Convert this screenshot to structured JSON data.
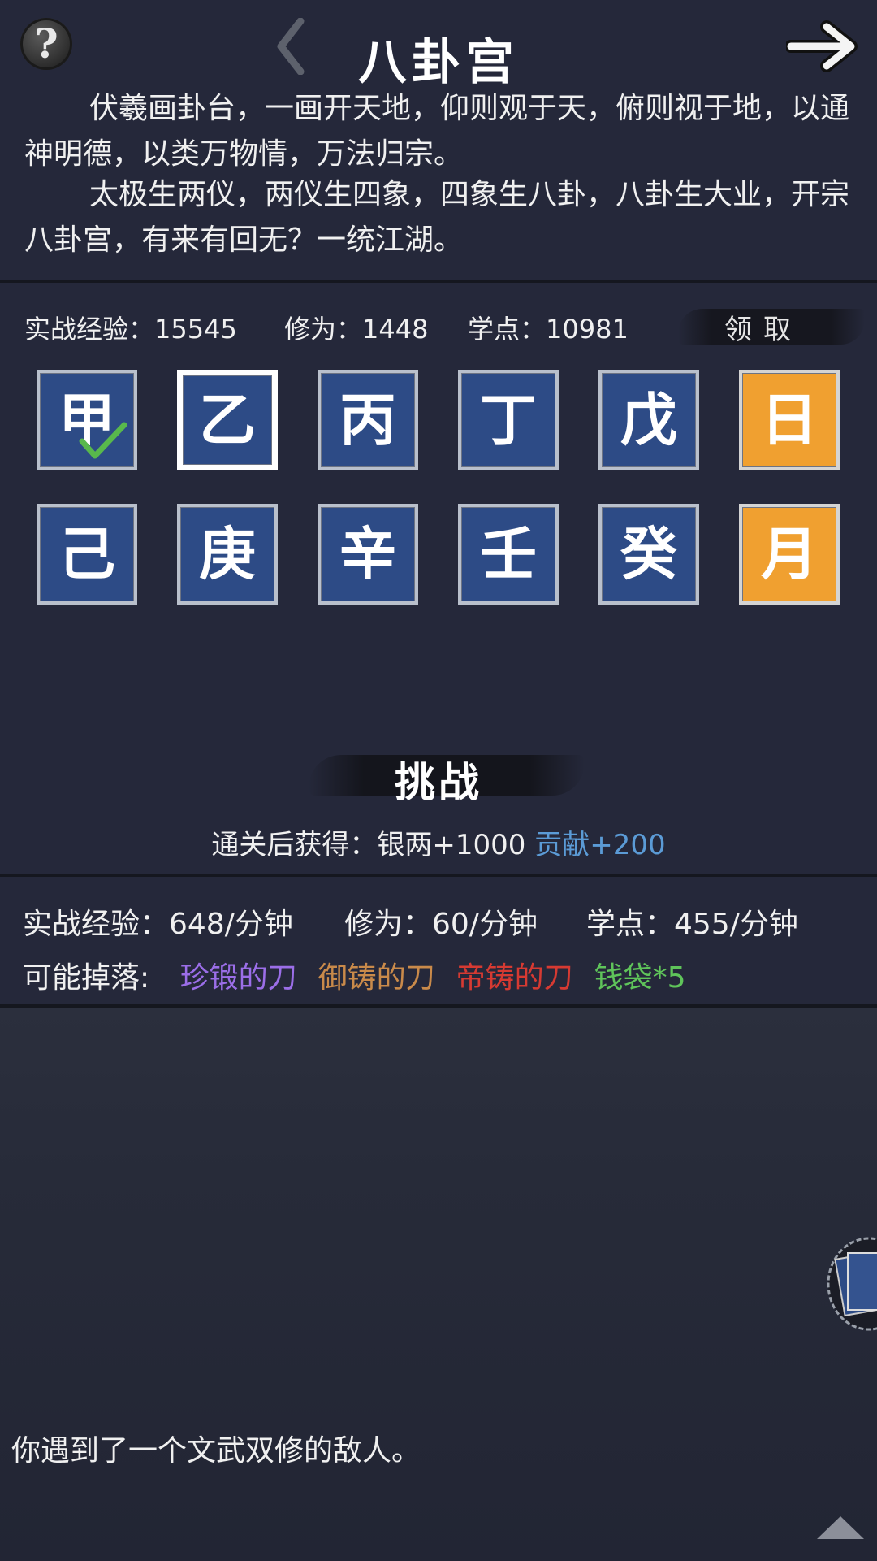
{
  "header": {
    "help_label": "?",
    "title": "八卦宫"
  },
  "intro": {
    "paragraph_1": "伏羲画卦台，一画开天地，仰则观于天，俯则视于地，以通神明德，以类万物情，万法归宗。",
    "paragraph_2": "太极生两仪，两仪生四象，四象生八卦，八卦生大业，开宗八卦宫，有来有回无？一统江湖。"
  },
  "stats": {
    "combat_exp": "实战经验：15545",
    "cultivation": "修为：1448",
    "study_points": "学点：10981",
    "claim_label": "领取"
  },
  "tiles": [
    {
      "char": "甲",
      "color": "blue",
      "completed": true
    },
    {
      "char": "乙",
      "color": "blue",
      "selected": true
    },
    {
      "char": "丙",
      "color": "blue"
    },
    {
      "char": "丁",
      "color": "blue"
    },
    {
      "char": "戊",
      "color": "blue"
    },
    {
      "char": "日",
      "color": "orange"
    },
    {
      "char": "己",
      "color": "blue"
    },
    {
      "char": "庚",
      "color": "blue"
    },
    {
      "char": "辛",
      "color": "blue"
    },
    {
      "char": "壬",
      "color": "blue"
    },
    {
      "char": "癸",
      "color": "blue"
    },
    {
      "char": "月",
      "color": "orange"
    }
  ],
  "challenge": {
    "label": "挑战",
    "reward_prefix": "通关后获得：银两+1000",
    "reward_contribution": "贡献+200",
    "contribution_color": "#5b9bd6"
  },
  "rates": {
    "combat_exp": "实战经验：648/分钟",
    "cultivation": "修为：60/分钟",
    "study_points": "学点：455/分钟"
  },
  "drops": {
    "label": "可能掉落:",
    "items": [
      {
        "name": "珍锻的刀",
        "color": "#9b6ee8"
      },
      {
        "name": "御铸的刀",
        "color": "#c98a4a"
      },
      {
        "name": "帝铸的刀",
        "color": "#d63a32"
      },
      {
        "name": "钱袋*5",
        "color": "#5fc45a"
      }
    ]
  },
  "log": {
    "message": "你遇到了一个文武双修的敌人。"
  },
  "icons": {
    "help": "question-icon",
    "prev": "chevron-left-icon",
    "next": "arrow-right-icon",
    "check": "checkmark-icon",
    "scroll": "triangle-up-icon"
  }
}
